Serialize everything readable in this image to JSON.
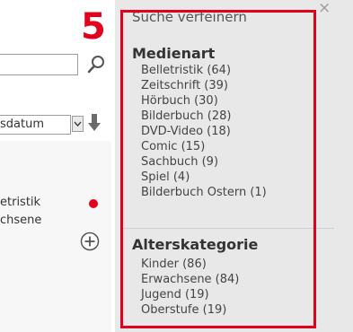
{
  "step_number": "5",
  "search": {
    "placeholder": ""
  },
  "sort": {
    "value": "sdatum"
  },
  "result": {
    "line1": "etristik",
    "line2": "chsene"
  },
  "panel": {
    "title": "Suche verfeinern",
    "close_symbol": "×",
    "groups": [
      {
        "title": "Medienart",
        "items": [
          "Belletristik (64)",
          "Zeitschrift (39)",
          "Hörbuch (30)",
          "Bilderbuch (28)",
          "DVD-Video (18)",
          "Comic (15)",
          "Sachbuch (9)",
          "Spiel (4)",
          "Bilderbuch Ostern (1)"
        ]
      },
      {
        "title": "Alterskategorie",
        "items": [
          "Kinder (86)",
          "Erwachsene (84)",
          "Jugend (19)",
          "Oberstufe (19)"
        ]
      }
    ]
  },
  "colors": {
    "highlight": "#e2001a",
    "panel_bg": "#e8e8e8",
    "dot": "#e2001a"
  }
}
